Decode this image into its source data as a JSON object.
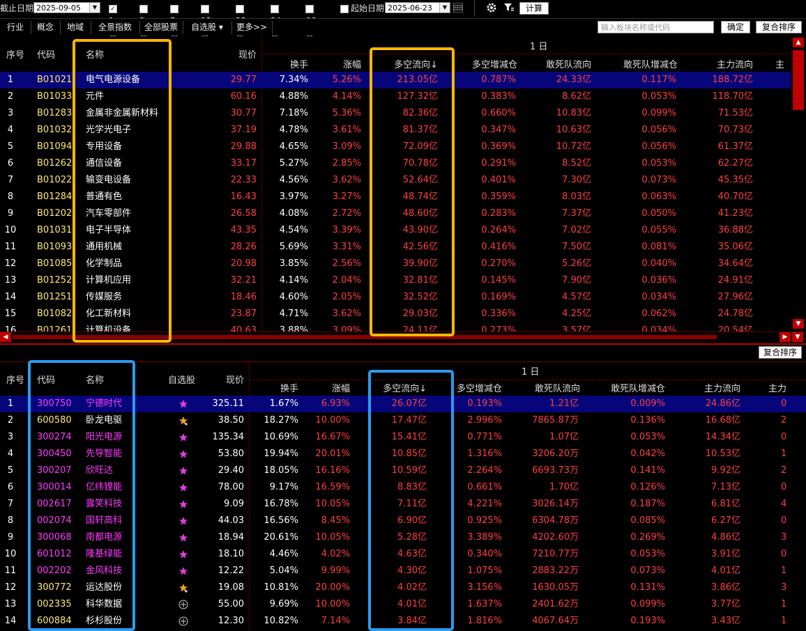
{
  "toolbar": {
    "end_date_label": "截止日期",
    "end_date": "2025-09-05",
    "periods": [
      {
        "label": "1日",
        "checked": true
      },
      {
        "label": "3日",
        "checked": false
      },
      {
        "label": "5日",
        "checked": false
      },
      {
        "label": "13日",
        "checked": false
      },
      {
        "label": "22日",
        "checked": false
      },
      {
        "label": "34日",
        "checked": false
      },
      {
        "label": "66日",
        "checked": false
      }
    ],
    "start_date_label": "起始日期",
    "start_date_checked": false,
    "start_date": "2025-06-23",
    "calc_label": "计算"
  },
  "tabs": [
    "行业",
    "概念",
    "地域",
    "全景指数",
    "全部股票",
    "自选股 ▾",
    "更多>>"
  ],
  "search": {
    "placeholder": "输入板块名称或代码",
    "confirm": "确定",
    "sort": "复合排序"
  },
  "top": {
    "period_title": "1  日",
    "columns": [
      "序号",
      "代码",
      "名称",
      "现价",
      "换手",
      "涨幅",
      "多空流向↓",
      "多空增减仓",
      "敢死队流向",
      "敢死队增减仓",
      "主力流向",
      "主"
    ],
    "rows": [
      [
        "1",
        "B01021",
        "电气电源设备",
        "29.77",
        "7.34%",
        "5.26%",
        "213.05亿",
        "0.787%",
        "24.33亿",
        "0.117%",
        "188.72亿"
      ],
      [
        "2",
        "B01033",
        "元件",
        "60.16",
        "4.88%",
        "4.14%",
        "127.32亿",
        "0.383%",
        "8.62亿",
        "0.053%",
        "118.70亿"
      ],
      [
        "3",
        "B01283",
        "金属非金属新材料",
        "30.77",
        "7.18%",
        "5.36%",
        "82.36亿",
        "0.660%",
        "10.83亿",
        "0.099%",
        "71.53亿"
      ],
      [
        "4",
        "B01032",
        "光学光电子",
        "37.19",
        "4.78%",
        "3.61%",
        "81.37亿",
        "0.347%",
        "10.63亿",
        "0.056%",
        "70.73亿"
      ],
      [
        "5",
        "B01094",
        "专用设备",
        "29.88",
        "4.65%",
        "3.09%",
        "72.09亿",
        "0.369%",
        "10.72亿",
        "0.056%",
        "61.37亿"
      ],
      [
        "6",
        "B01262",
        "通信设备",
        "33.17",
        "5.27%",
        "2.85%",
        "70.78亿",
        "0.291%",
        "8.52亿",
        "0.053%",
        "62.27亿"
      ],
      [
        "7",
        "B01022",
        "输变电设备",
        "22.33",
        "4.56%",
        "3.62%",
        "52.64亿",
        "0.401%",
        "7.30亿",
        "0.073%",
        "45.35亿"
      ],
      [
        "8",
        "B01284",
        "普通有色",
        "16.43",
        "3.97%",
        "3.27%",
        "48.74亿",
        "0.359%",
        "8.03亿",
        "0.063%",
        "40.70亿"
      ],
      [
        "9",
        "B01202",
        "汽车零部件",
        "26.58",
        "4.08%",
        "2.72%",
        "48.60亿",
        "0.283%",
        "7.37亿",
        "0.050%",
        "41.23亿"
      ],
      [
        "10",
        "B01031",
        "电子半导体",
        "43.35",
        "4.54%",
        "3.39%",
        "43.90亿",
        "0.264%",
        "7.02亿",
        "0.055%",
        "36.88亿"
      ],
      [
        "11",
        "B01093",
        "通用机械",
        "28.26",
        "5.69%",
        "3.31%",
        "42.56亿",
        "0.416%",
        "7.50亿",
        "0.081%",
        "35.06亿"
      ],
      [
        "12",
        "B01085",
        "化学制品",
        "20.98",
        "3.85%",
        "2.56%",
        "39.90亿",
        "0.270%",
        "5.26亿",
        "0.040%",
        "34.64亿"
      ],
      [
        "13",
        "B01252",
        "计算机应用",
        "32.21",
        "4.14%",
        "2.04%",
        "32.81亿",
        "0.145%",
        "7.90亿",
        "0.036%",
        "24.91亿"
      ],
      [
        "14",
        "B01251",
        "传媒服务",
        "18.46",
        "4.60%",
        "2.05%",
        "32.52亿",
        "0.169%",
        "4.57亿",
        "0.034%",
        "27.96亿"
      ],
      [
        "15",
        "B01082",
        "化工新材料",
        "23.87",
        "4.71%",
        "3.62%",
        "29.03亿",
        "0.336%",
        "4.25亿",
        "0.062%",
        "24.78亿"
      ],
      [
        "16",
        "B01261",
        "计算机设备",
        "40.63",
        "3.88%",
        "3.09%",
        "24.11亿",
        "0.273%",
        "3.57亿",
        "0.034%",
        "20.54亿"
      ]
    ]
  },
  "bottom": {
    "sort_label": "复合排序",
    "period_title": "1  日",
    "columns": [
      "序号",
      "代码",
      "名称",
      "自选股",
      "现价",
      "换手",
      "涨幅",
      "多空流向↓",
      "多空增减仓",
      "敢死队流向",
      "敢死队增减仓",
      "主力流向",
      "主力"
    ],
    "rows": [
      [
        "1",
        "300750",
        "宁德时代",
        "star",
        "325.11",
        "1.67%",
        "6.93%",
        "26.07亿",
        "0.193%",
        "1.21亿",
        "0.009%",
        "24.86亿",
        "0"
      ],
      [
        "2",
        "600580",
        "卧龙电驱",
        "star-add",
        "38.50",
        "18.27%",
        "10.00%",
        "17.47亿",
        "2.996%",
        "7865.87万",
        "0.136%",
        "16.68亿",
        "2"
      ],
      [
        "3",
        "300274",
        "阳光电源",
        "star",
        "135.34",
        "10.69%",
        "16.67%",
        "15.41亿",
        "0.771%",
        "1.07亿",
        "0.053%",
        "14.34亿",
        "0"
      ],
      [
        "4",
        "300450",
        "先导智能",
        "star",
        "53.80",
        "19.94%",
        "20.01%",
        "10.85亿",
        "1.316%",
        "3206.20万",
        "0.042%",
        "10.53亿",
        "1"
      ],
      [
        "5",
        "300207",
        "欣旺达",
        "star",
        "29.40",
        "18.05%",
        "16.16%",
        "10.59亿",
        "2.264%",
        "6693.73万",
        "0.141%",
        "9.92亿",
        "2"
      ],
      [
        "6",
        "300014",
        "亿纬锂能",
        "star",
        "78.00",
        "9.17%",
        "16.59%",
        "8.83亿",
        "0.661%",
        "1.70亿",
        "0.126%",
        "7.13亿",
        "0"
      ],
      [
        "7",
        "002617",
        "露笑科技",
        "star",
        "9.09",
        "16.78%",
        "10.05%",
        "7.11亿",
        "4.221%",
        "3026.14万",
        "0.187%",
        "6.81亿",
        "4"
      ],
      [
        "8",
        "002074",
        "国轩高科",
        "star",
        "44.03",
        "16.56%",
        "8.45%",
        "6.90亿",
        "0.925%",
        "6304.78万",
        "0.085%",
        "6.27亿",
        "0"
      ],
      [
        "9",
        "300068",
        "南都电源",
        "star",
        "18.94",
        "20.61%",
        "10.05%",
        "5.28亿",
        "3.389%",
        "4202.60万",
        "0.269%",
        "4.86亿",
        "3"
      ],
      [
        "10",
        "601012",
        "隆基绿能",
        "star",
        "18.10",
        "4.46%",
        "4.02%",
        "4.63亿",
        "0.340%",
        "7210.77万",
        "0.053%",
        "3.91亿",
        "0"
      ],
      [
        "11",
        "002202",
        "金风科技",
        "star",
        "12.22",
        "5.04%",
        "9.99%",
        "4.30亿",
        "1.075%",
        "2883.22万",
        "0.073%",
        "4.01亿",
        "1"
      ],
      [
        "12",
        "300772",
        "运达股份",
        "star-add",
        "19.08",
        "10.81%",
        "20.00%",
        "4.02亿",
        "3.156%",
        "1630.05万",
        "0.131%",
        "3.86亿",
        "3"
      ],
      [
        "13",
        "002335",
        "科华数据",
        "plus",
        "55.00",
        "9.69%",
        "10.00%",
        "4.01亿",
        "1.637%",
        "2401.62万",
        "0.099%",
        "3.77亿",
        "1"
      ],
      [
        "14",
        "600884",
        "杉杉股份",
        "plus",
        "12.30",
        "10.82%",
        "7.14%",
        "3.84亿",
        "1.816%",
        "4067.64万",
        "0.193%",
        "3.43亿",
        "1"
      ]
    ],
    "magenta_codes": [
      "300750",
      "300274",
      "300450",
      "300207",
      "300014",
      "002617",
      "002074",
      "300068",
      "601012",
      "002202"
    ]
  },
  "colors": {
    "highlight_orange": "#ffb800",
    "highlight_blue": "#2a9bf0",
    "selected_row": "#06067a",
    "up_red": "#ff4040",
    "code_yellow": "#ffe873",
    "watch_magenta": "#ff3cff"
  }
}
